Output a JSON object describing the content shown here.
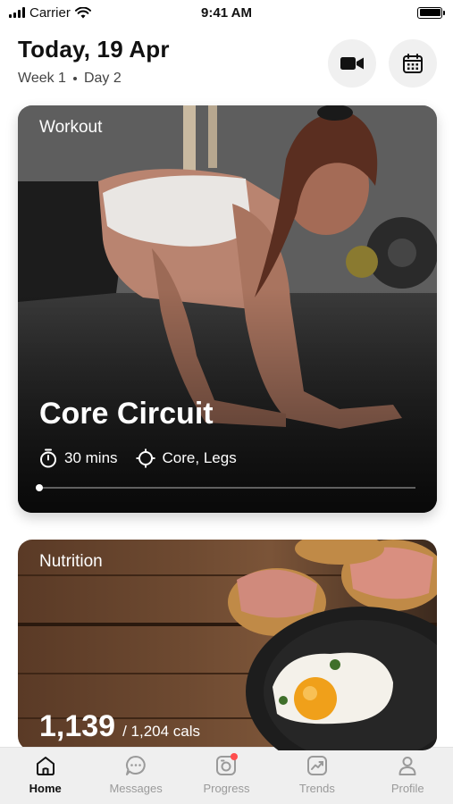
{
  "status_bar": {
    "carrier": "Carrier",
    "time": "9:41 AM"
  },
  "header": {
    "title": "Today, 19 Apr",
    "week": "Week 1",
    "day": "Day 2"
  },
  "header_actions": [
    {
      "icon": "video-icon"
    },
    {
      "icon": "calendar-icon"
    }
  ],
  "workout": {
    "label": "Workout",
    "title": "Core Circuit",
    "duration": "30 mins",
    "focus": "Core, Legs",
    "progress": 0
  },
  "nutrition": {
    "label": "Nutrition",
    "calories": "1,139",
    "target": "/ 1,204 cals"
  },
  "tabs": [
    {
      "label": "Home",
      "icon": "home-icon",
      "active": true
    },
    {
      "label": "Messages",
      "icon": "messages-icon",
      "active": false
    },
    {
      "label": "Progress",
      "icon": "progress-camera-icon",
      "active": false,
      "badge": true
    },
    {
      "label": "Trends",
      "icon": "trends-icon",
      "active": false
    },
    {
      "label": "Profile",
      "icon": "profile-icon",
      "active": false
    }
  ],
  "colors": {
    "badge": "#ff4d4d",
    "tab_active": "#111111",
    "tab_inactive": "#9a9a9a"
  }
}
